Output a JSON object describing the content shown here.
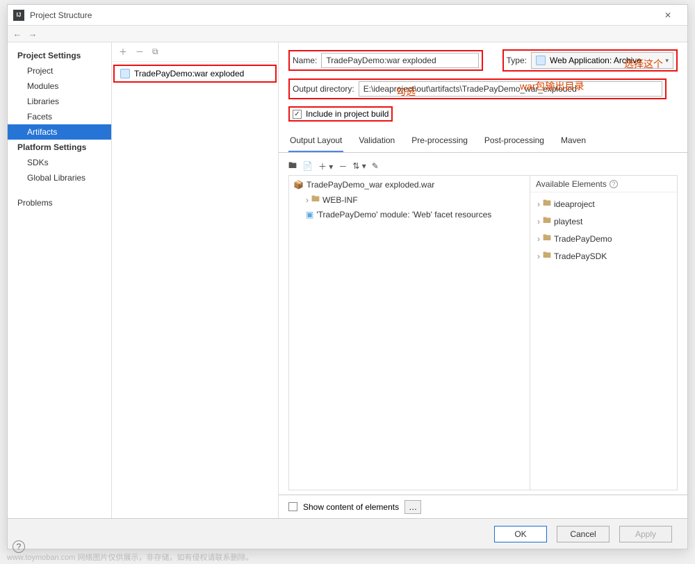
{
  "window": {
    "title": "Project Structure"
  },
  "sidebar": {
    "section1": "Project Settings",
    "items1": [
      "Project",
      "Modules",
      "Libraries",
      "Facets",
      "Artifacts"
    ],
    "selected1": 4,
    "section2": "Platform Settings",
    "items2": [
      "SDKs",
      "Global Libraries"
    ],
    "section3_item": "Problems"
  },
  "artifacts": {
    "list": [
      "TradePayDemo:war exploded"
    ]
  },
  "form": {
    "name_label": "Name:",
    "name_value": "TradePayDemo:war exploded",
    "type_label": "Type:",
    "type_value": "Web Application: Archive",
    "outdir_label": "Output directory:",
    "outdir_value": "E:\\ideaproject\\out\\artifacts\\TradePayDemo_war_exploded",
    "include_build": "Include in project build",
    "include_checked": true
  },
  "tabs": [
    "Output Layout",
    "Validation",
    "Pre-processing",
    "Post-processing",
    "Maven"
  ],
  "tab_active": 0,
  "layout_tree": [
    {
      "label": "TradePayDemo_war exploded.war",
      "indent": 0,
      "icon": "archive-icon"
    },
    {
      "label": "WEB-INF",
      "indent": 1,
      "icon": "folder-icon",
      "expandable": true
    },
    {
      "label": "'TradePayDemo' module: 'Web' facet resources",
      "indent": 1,
      "icon": "module-icon"
    }
  ],
  "available": {
    "header": "Available Elements",
    "items": [
      "ideaproject",
      "playtest",
      "TradePayDemo",
      "TradePaySDK"
    ]
  },
  "bottom": {
    "show_content": "Show content of elements"
  },
  "buttons": {
    "ok": "OK",
    "cancel": "Cancel",
    "apply": "Apply"
  },
  "annotations": {
    "select_this": "选择这个",
    "check": "勾选",
    "war_out": "war包输出目录"
  },
  "watermark": "www.toymoban.com 网络图片仅供展示，非存储，如有侵权请联系删除。"
}
